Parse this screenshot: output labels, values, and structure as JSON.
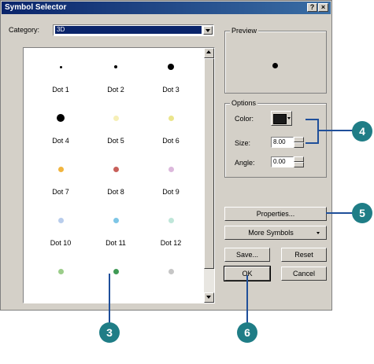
{
  "window": {
    "title": "Symbol Selector",
    "help_glyph": "?",
    "close_glyph": "×"
  },
  "category": {
    "label": "Category:",
    "value": "3D"
  },
  "symbols": [
    {
      "label": "Dot 1",
      "color": "#000000"
    },
    {
      "label": "Dot 2",
      "color": "#000000"
    },
    {
      "label": "Dot 3",
      "color": "#000000"
    },
    {
      "label": "Dot 4",
      "color": "#000000"
    },
    {
      "label": "Dot 5",
      "color": "#f6efb6"
    },
    {
      "label": "Dot 6",
      "color": "#ebe58c"
    },
    {
      "label": "Dot 7",
      "color": "#f1b53f"
    },
    {
      "label": "Dot 8",
      "color": "#c8605a"
    },
    {
      "label": "Dot 9",
      "color": "#dcb8dc"
    },
    {
      "label": "Dot 10",
      "color": "#b9cdec"
    },
    {
      "label": "Dot 11",
      "color": "#7ec6e6"
    },
    {
      "label": "Dot 12",
      "color": "#bfe6d9"
    },
    {
      "label": "",
      "color": "#9bcd8a"
    },
    {
      "label": "",
      "color": "#3f9a55"
    },
    {
      "label": "",
      "color": "#c6c6c6"
    }
  ],
  "preview": {
    "title": "Preview",
    "symbol_color": "#000000"
  },
  "options": {
    "title": "Options",
    "color_label": "Color:",
    "color_value": "#1a1a1a",
    "size_label": "Size:",
    "size_value": "8.00",
    "angle_label": "Angle:",
    "angle_value": "0.00"
  },
  "buttons": {
    "properties": "Properties...",
    "more_symbols": "More Symbols",
    "save": "Save...",
    "reset": "Reset",
    "ok": "OK",
    "cancel": "Cancel"
  },
  "callouts": {
    "c3": "3",
    "c4": "4",
    "c5": "5",
    "c6": "6"
  },
  "colors": {
    "callout": "#1f7d86",
    "leader": "#1f4f9a",
    "titlebar": "#0a246a"
  }
}
